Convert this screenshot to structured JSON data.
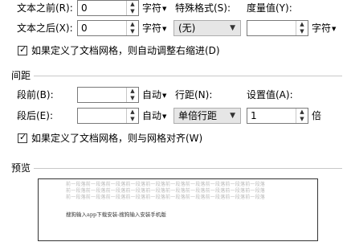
{
  "indent": {
    "before_label": "文本之前(R):",
    "before_value": "0",
    "before_unit": "字符",
    "after_label": "文本之后(X):",
    "after_value": "0",
    "after_unit": "字符",
    "special_label": "特殊格式(S):",
    "special_value": "(无)",
    "measure_label": "度量值(Y):",
    "measure_value": "",
    "measure_unit": "字符",
    "grid_checkbox_label": "如果定义了文档网格，则自动调整右缩进(D)",
    "grid_checkbox_checked": true
  },
  "spacing": {
    "section_title": "间距",
    "before_label": "段前(B):",
    "before_value": "",
    "before_unit": "自动",
    "after_label": "段后(E):",
    "after_value": "",
    "after_unit": "自动",
    "line_label": "行距(N):",
    "line_value": "单倍行距",
    "setting_label": "设置值(A):",
    "setting_value": "1",
    "setting_unit": "倍",
    "grid_checkbox_label": "如果定义了文档网格，则与网格对齐(W)",
    "grid_checkbox_checked": true
  },
  "preview": {
    "section_title": "预览",
    "placeholder_lines": [
      "前一段落前一段落前一段落前一段落前一段落前一段落前一段落前一段落前一段落前一段落",
      "前一段落前一段落前一段落前一段落前一段落前一段落前一段落前一段落前一段落前一段落",
      "前一段落前一段落前一段落前一段落前一段落前一段落前一段落前一段落前一段落前一段落"
    ],
    "sample_text": "搜狗输入app下载安装-搜狗输入安装手机版"
  },
  "icons": {
    "spin_up": "spin-up-arrow-icon",
    "spin_down": "spin-down-arrow-icon",
    "dropdown": "dropdown-arrow-icon",
    "check": "checkmark-icon"
  }
}
